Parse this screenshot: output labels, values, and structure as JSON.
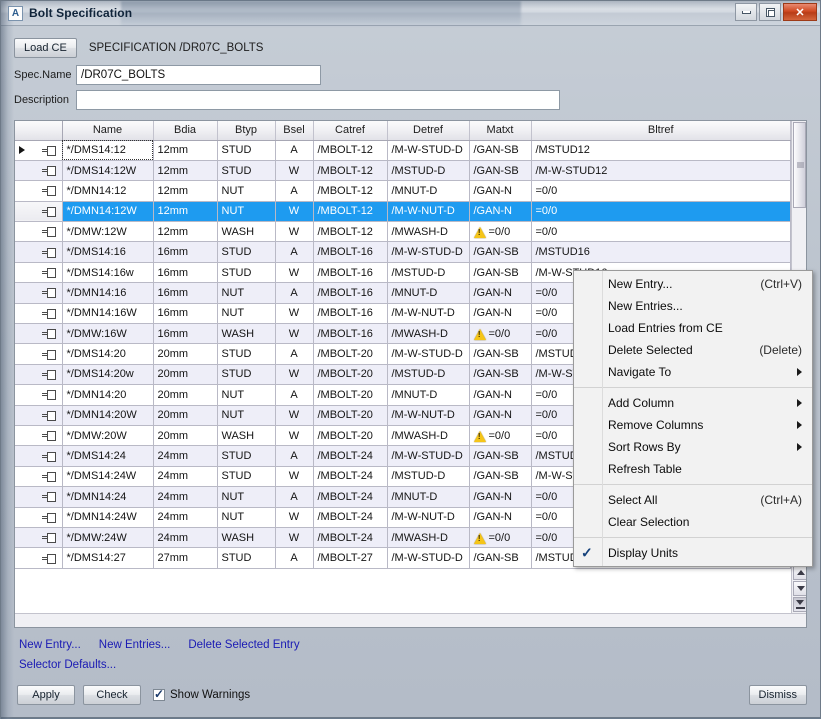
{
  "window": {
    "title": "Bolt Specification",
    "app_icon": "app-icon-A",
    "minimize_label": "minimize-icon",
    "maximize_label": "maximize-icon",
    "close_label": "✕"
  },
  "top_bar": {
    "load_ce_label": "Load CE",
    "spec_caption": "SPECIFICATION /DR07C_BOLTS"
  },
  "fields": [
    {
      "label": "Spec.Name",
      "value": "/DR07C_BOLTS",
      "placeholder": ""
    },
    {
      "label": "Description",
      "value": "",
      "placeholder": ""
    }
  ],
  "table": {
    "columns": [
      "Name",
      "Bdia",
      "Btyp",
      "Bsel",
      "Catref",
      "Detref",
      "Matxt",
      "Bltref"
    ],
    "rows": [
      {
        "name": "*/DMS14:12",
        "bdia": "12mm",
        "btyp": "STUD",
        "bsel": "A",
        "catref": "/MBOLT-12",
        "detref": "/M-W-STUD-D",
        "matxt": "/GAN-SB",
        "matxt_warn": false,
        "bltref": "/MSTUD12",
        "style": "plain",
        "current": true,
        "selected": false
      },
      {
        "name": "*/DMS14:12W",
        "bdia": "12mm",
        "btyp": "STUD",
        "bsel": "W",
        "catref": "/MBOLT-12",
        "detref": "/MSTUD-D",
        "matxt": "/GAN-SB",
        "matxt_warn": false,
        "bltref": "/M-W-STUD12",
        "style": "alt",
        "current": false,
        "selected": false
      },
      {
        "name": "*/DMN14:12",
        "bdia": "12mm",
        "btyp": "NUT",
        "bsel": "A",
        "catref": "/MBOLT-12",
        "detref": "/MNUT-D",
        "matxt": "/GAN-N",
        "matxt_warn": false,
        "bltref": "=0/0",
        "style": "plain",
        "current": false,
        "selected": false
      },
      {
        "name": "*/DMN14:12W",
        "bdia": "12mm",
        "btyp": "NUT",
        "bsel": "W",
        "catref": "/MBOLT-12",
        "detref": "/M-W-NUT-D",
        "matxt": "/GAN-N",
        "matxt_warn": false,
        "bltref": "=0/0",
        "style": "sel",
        "current": false,
        "selected": true
      },
      {
        "name": "*/DMW:12W",
        "bdia": "12mm",
        "btyp": "WASH",
        "bsel": "W",
        "catref": "/MBOLT-12",
        "detref": "/MWASH-D",
        "matxt": "=0/0",
        "matxt_warn": true,
        "bltref": "=0/0",
        "style": "plain",
        "current": false,
        "selected": false
      },
      {
        "name": "*/DMS14:16",
        "bdia": "16mm",
        "btyp": "STUD",
        "bsel": "A",
        "catref": "/MBOLT-16",
        "detref": "/M-W-STUD-D",
        "matxt": "/GAN-SB",
        "matxt_warn": false,
        "bltref": "/MSTUD16",
        "style": "alt",
        "current": false,
        "selected": false
      },
      {
        "name": "*/DMS14:16w",
        "bdia": "16mm",
        "btyp": "STUD",
        "bsel": "W",
        "catref": "/MBOLT-16",
        "detref": "/MSTUD-D",
        "matxt": "/GAN-SB",
        "matxt_warn": false,
        "bltref": "/M-W-STUD16",
        "style": "plain",
        "current": false,
        "selected": false
      },
      {
        "name": "*/DMN14:16",
        "bdia": "16mm",
        "btyp": "NUT",
        "bsel": "A",
        "catref": "/MBOLT-16",
        "detref": "/MNUT-D",
        "matxt": "/GAN-N",
        "matxt_warn": false,
        "bltref": "=0/0",
        "style": "alt",
        "current": false,
        "selected": false
      },
      {
        "name": "*/DMN14:16W",
        "bdia": "16mm",
        "btyp": "NUT",
        "bsel": "W",
        "catref": "/MBOLT-16",
        "detref": "/M-W-NUT-D",
        "matxt": "/GAN-N",
        "matxt_warn": false,
        "bltref": "=0/0",
        "style": "plain",
        "current": false,
        "selected": false
      },
      {
        "name": "*/DMW:16W",
        "bdia": "16mm",
        "btyp": "WASH",
        "bsel": "W",
        "catref": "/MBOLT-16",
        "detref": "/MWASH-D",
        "matxt": "=0/0",
        "matxt_warn": true,
        "bltref": "=0/0",
        "style": "alt",
        "current": false,
        "selected": false
      },
      {
        "name": "*/DMS14:20",
        "bdia": "20mm",
        "btyp": "STUD",
        "bsel": "A",
        "catref": "/MBOLT-20",
        "detref": "/M-W-STUD-D",
        "matxt": "/GAN-SB",
        "matxt_warn": false,
        "bltref": "/MSTUD20",
        "style": "plain",
        "current": false,
        "selected": false
      },
      {
        "name": "*/DMS14:20w",
        "bdia": "20mm",
        "btyp": "STUD",
        "bsel": "W",
        "catref": "/MBOLT-20",
        "detref": "/MSTUD-D",
        "matxt": "/GAN-SB",
        "matxt_warn": false,
        "bltref": "/M-W-STUD20",
        "style": "alt",
        "current": false,
        "selected": false
      },
      {
        "name": "*/DMN14:20",
        "bdia": "20mm",
        "btyp": "NUT",
        "bsel": "A",
        "catref": "/MBOLT-20",
        "detref": "/MNUT-D",
        "matxt": "/GAN-N",
        "matxt_warn": false,
        "bltref": "=0/0",
        "style": "plain",
        "current": false,
        "selected": false
      },
      {
        "name": "*/DMN14:20W",
        "bdia": "20mm",
        "btyp": "NUT",
        "bsel": "W",
        "catref": "/MBOLT-20",
        "detref": "/M-W-NUT-D",
        "matxt": "/GAN-N",
        "matxt_warn": false,
        "bltref": "=0/0",
        "style": "alt",
        "current": false,
        "selected": false
      },
      {
        "name": "*/DMW:20W",
        "bdia": "20mm",
        "btyp": "WASH",
        "bsel": "W",
        "catref": "/MBOLT-20",
        "detref": "/MWASH-D",
        "matxt": "=0/0",
        "matxt_warn": true,
        "bltref": "=0/0",
        "style": "plain",
        "current": false,
        "selected": false
      },
      {
        "name": "*/DMS14:24",
        "bdia": "24mm",
        "btyp": "STUD",
        "bsel": "A",
        "catref": "/MBOLT-24",
        "detref": "/M-W-STUD-D",
        "matxt": "/GAN-SB",
        "matxt_warn": false,
        "bltref": "/MSTUD24",
        "style": "alt",
        "current": false,
        "selected": false
      },
      {
        "name": "*/DMS14:24W",
        "bdia": "24mm",
        "btyp": "STUD",
        "bsel": "W",
        "catref": "/MBOLT-24",
        "detref": "/MSTUD-D",
        "matxt": "/GAN-SB",
        "matxt_warn": false,
        "bltref": "/M-W-STUD24",
        "style": "plain",
        "current": false,
        "selected": false
      },
      {
        "name": "*/DMN14:24",
        "bdia": "24mm",
        "btyp": "NUT",
        "bsel": "A",
        "catref": "/MBOLT-24",
        "detref": "/MNUT-D",
        "matxt": "/GAN-N",
        "matxt_warn": false,
        "bltref": "=0/0",
        "style": "alt",
        "current": false,
        "selected": false
      },
      {
        "name": "*/DMN14:24W",
        "bdia": "24mm",
        "btyp": "NUT",
        "bsel": "W",
        "catref": "/MBOLT-24",
        "detref": "/M-W-NUT-D",
        "matxt": "/GAN-N",
        "matxt_warn": false,
        "bltref": "=0/0",
        "style": "plain",
        "current": false,
        "selected": false
      },
      {
        "name": "*/DMW:24W",
        "bdia": "24mm",
        "btyp": "WASH",
        "bsel": "W",
        "catref": "/MBOLT-24",
        "detref": "/MWASH-D",
        "matxt": "=0/0",
        "matxt_warn": true,
        "bltref": "=0/0",
        "style": "alt",
        "current": false,
        "selected": false
      },
      {
        "name": "*/DMS14:27",
        "bdia": "27mm",
        "btyp": "STUD",
        "bsel": "A",
        "catref": "/MBOLT-27",
        "detref": "/M-W-STUD-D",
        "matxt": "/GAN-SB",
        "matxt_warn": false,
        "bltref": "/MSTUD27",
        "style": "plain",
        "current": false,
        "selected": false
      }
    ]
  },
  "context_menu": {
    "items": [
      {
        "label": "New Entry...",
        "accel": "(Ctrl+V)",
        "submenu": false,
        "checked": false,
        "sep_after": false
      },
      {
        "label": "New Entries...",
        "accel": "",
        "submenu": false,
        "checked": false,
        "sep_after": false
      },
      {
        "label": "Load Entries from CE",
        "accel": "",
        "submenu": false,
        "checked": false,
        "sep_after": false
      },
      {
        "label": "Delete Selected",
        "accel": "(Delete)",
        "submenu": false,
        "checked": false,
        "sep_after": false
      },
      {
        "label": "Navigate To",
        "accel": "",
        "submenu": true,
        "checked": false,
        "sep_after": true
      },
      {
        "label": "Add Column",
        "accel": "",
        "submenu": true,
        "checked": false,
        "sep_after": false
      },
      {
        "label": "Remove Columns",
        "accel": "",
        "submenu": true,
        "checked": false,
        "sep_after": false
      },
      {
        "label": "Sort Rows By",
        "accel": "",
        "submenu": true,
        "checked": false,
        "sep_after": false
      },
      {
        "label": "Refresh Table",
        "accel": "",
        "submenu": false,
        "checked": false,
        "sep_after": true
      },
      {
        "label": "Select All",
        "accel": "(Ctrl+A)",
        "submenu": false,
        "checked": false,
        "sep_after": false
      },
      {
        "label": "Clear Selection",
        "accel": "",
        "submenu": false,
        "checked": false,
        "sep_after": true
      },
      {
        "label": "Display Units",
        "accel": "",
        "submenu": false,
        "checked": true,
        "sep_after": false
      }
    ]
  },
  "footer": {
    "links_row1": [
      "New Entry...",
      "New Entries...",
      "Delete Selected Entry"
    ],
    "links_row2": [
      "Selector Defaults..."
    ],
    "apply_label": "Apply",
    "check_label": "Check",
    "show_warnings_label": "Show Warnings",
    "show_warnings_checked": true,
    "dismiss_label": "Dismiss"
  },
  "colors": {
    "selection_blue": "#1e9bf0",
    "alt_row": "#eeeef8",
    "link": "#1a1ab4",
    "warning_yellow": "#f5c518",
    "close_red": "#cf4a22"
  }
}
